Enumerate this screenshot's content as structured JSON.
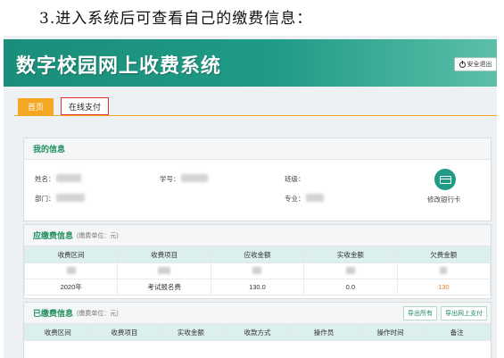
{
  "caption": "3.进入系统后可查看自己的缴费信息：",
  "banner": {
    "title": "数字校园网上收费系统",
    "logout_label": "安全退出"
  },
  "tabs": [
    {
      "label": "首页"
    },
    {
      "label": "在线支付"
    }
  ],
  "my_info": {
    "title": "我的信息",
    "fields": {
      "name": "姓名：",
      "student_id": "学号：",
      "class": "班级：",
      "department": "部门：",
      "major": "专业："
    },
    "bank_card_label": "修改银行卡"
  },
  "due_info": {
    "title": "应缴费信息",
    "unit": "(缴费单位：元)",
    "columns": [
      "收费区间",
      "收费项目",
      "应收金额",
      "实收金额",
      "欠费金额"
    ],
    "rows": [
      {
        "period": "2020年",
        "item": "考试报名费",
        "due": "130.0",
        "received": "0.0",
        "owed": "130"
      }
    ]
  },
  "paid_info": {
    "title": "已缴费信息",
    "unit": "(缴费单位：元)",
    "export_all_label": "导出所有",
    "export_online_label": "导出网上支付",
    "columns": [
      "收费区间",
      "收费项目",
      "实收金额",
      "收款方式",
      "操作员",
      "操作时间",
      "备注"
    ]
  }
}
